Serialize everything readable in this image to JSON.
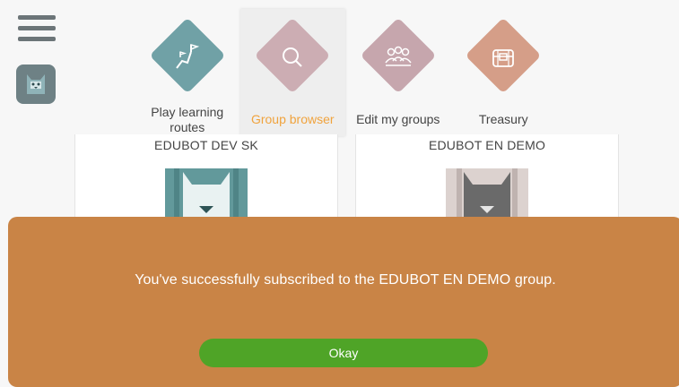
{
  "menu": {
    "icon": "hamburger-menu-icon"
  },
  "profile": {
    "icon": "robot-avatar-icon"
  },
  "nav": {
    "items": [
      {
        "label_line1": "Play learning",
        "label_line2": "routes",
        "icon": "route-flag-icon",
        "color": "#70a1a6"
      },
      {
        "label": "Group browser",
        "icon": "search-icon",
        "color": "#ccadb3",
        "selected": true
      },
      {
        "label": "Edit my groups",
        "icon": "people-group-icon",
        "color": "#c6a6ad"
      },
      {
        "label": "Treasury",
        "icon": "treasure-chest-icon",
        "color": "#d59e88"
      }
    ]
  },
  "groups": [
    {
      "name": "EDUBOT DEV SK",
      "accent": "#62999b"
    },
    {
      "name": "EDUBOT EN DEMO",
      "accent": "#6a6a6a"
    }
  ],
  "dialog": {
    "message": "You've successfully subscribed to the EDUBOT EN DEMO group.",
    "okay_label": "Okay",
    "background": "#c98446",
    "button_color": "#4fa427"
  }
}
